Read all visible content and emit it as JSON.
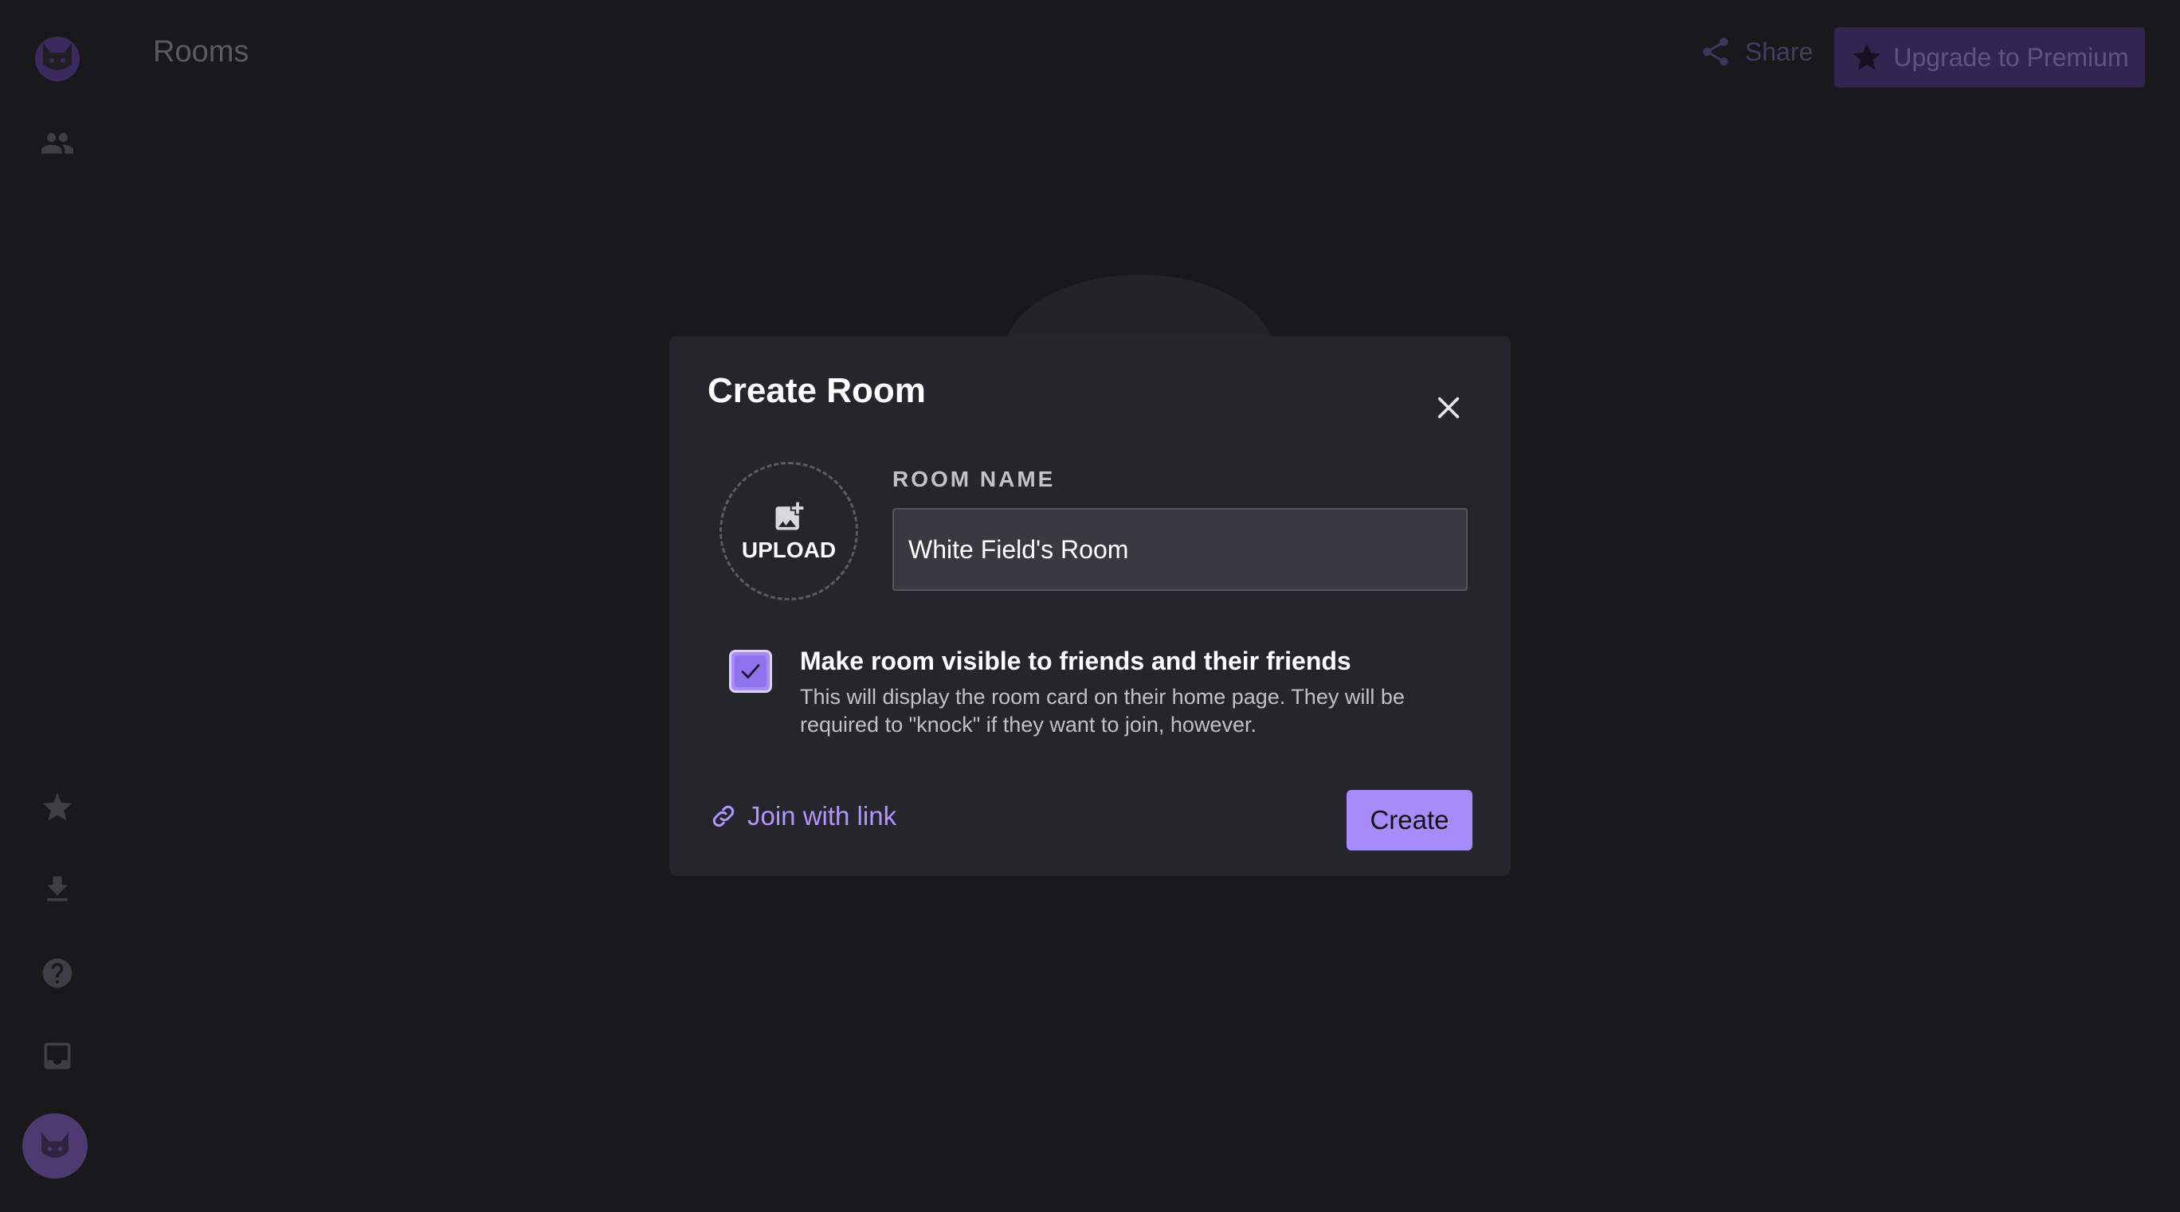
{
  "app": {
    "page_title": "Rooms"
  },
  "header": {
    "share_label": "Share",
    "upgrade_label": "Upgrade to Premium"
  },
  "sidebar": {
    "icons": [
      "app-logo-icon",
      "friends-icon",
      "star-icon",
      "download-icon",
      "help-icon",
      "inbox-icon",
      "avatar"
    ]
  },
  "modal": {
    "title": "Create Room",
    "upload_label": "UPLOAD",
    "room_name_label": "ROOM NAME",
    "room_name_value": "White Field's Room",
    "visibility_checked": true,
    "visibility_title": "Make room visible to friends and their friends",
    "visibility_description": "This will display the room card on their home page. They will be required to \"knock\" if they want to join, however.",
    "join_link_label": "Join with link",
    "create_label": "Create"
  },
  "colors": {
    "accent": "#a78bfa",
    "link": "#b594ff",
    "modal_bg": "#25262b",
    "page_bg": "#19191b"
  }
}
